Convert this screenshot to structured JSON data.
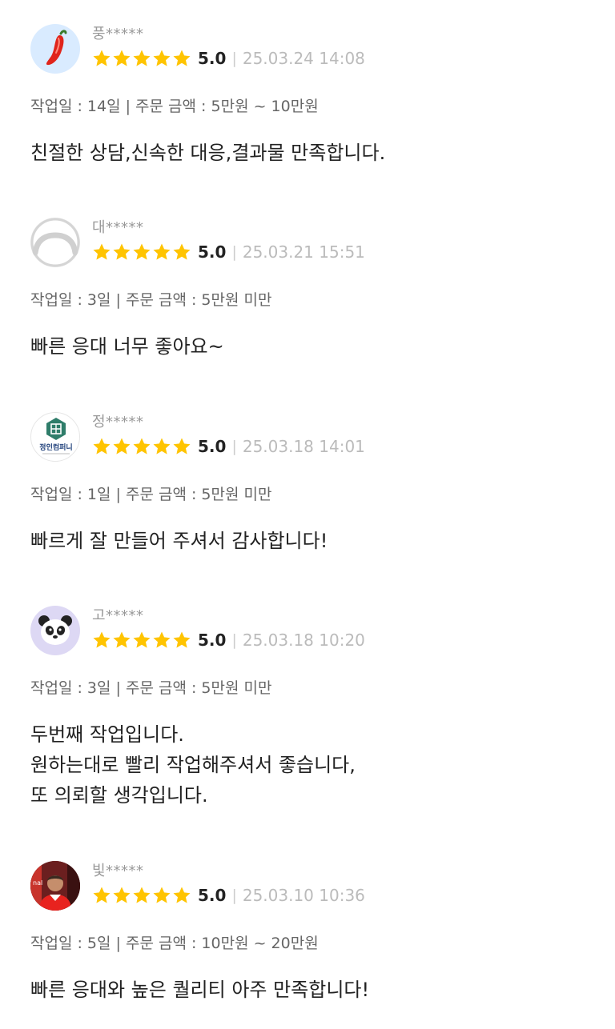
{
  "colors": {
    "star": "#FFC400",
    "date": "#BBBBBB",
    "meta": "#666666"
  },
  "reviews": [
    {
      "avatar_icon": "chili-pepper-icon",
      "nick": "풍*****",
      "score": "5.0",
      "stars": 5,
      "date": "25.03.24 14:08",
      "meta": "작업일 : 14일 | 주문 금액 : 5만원 ~ 10만원",
      "lines": [
        "친절한 상담,신속한 대응,결과물 만족합니다."
      ]
    },
    {
      "avatar_icon": "default-profile-icon",
      "nick": "대*****",
      "score": "5.0",
      "stars": 5,
      "date": "25.03.21 15:51",
      "meta": "작업일 : 3일 | 주문 금액 : 5만원 미만",
      "lines": [
        "빠른 응대 너무 좋아요~"
      ]
    },
    {
      "avatar_icon": "company-logo-icon",
      "avatar_text": "정인컴퍼니",
      "nick": "정*****",
      "score": "5.0",
      "stars": 5,
      "date": "25.03.18 14:01",
      "meta": "작업일 : 1일 | 주문 금액 : 5만원 미만",
      "lines": [
        "빠르게 잘 만들어 주셔서 감사합니다!"
      ]
    },
    {
      "avatar_icon": "panda-icon",
      "nick": "고*****",
      "score": "5.0",
      "stars": 5,
      "date": "25.03.18 10:20",
      "meta": "작업일 : 3일 | 주문 금액 : 5만원 미만",
      "lines": [
        "두번째 작업입니다.",
        "원하는대로 빨리 작업해주셔서 좋습니다,",
        "또 의뢰할 생각입니다."
      ]
    },
    {
      "avatar_icon": "football-player-photo-icon",
      "nick": "빛*****",
      "score": "5.0",
      "stars": 5,
      "date": "25.03.10 10:36",
      "meta": "작업일 : 5일 | 주문 금액 : 10만원 ~ 20만원",
      "lines": [
        "빠른 응대와 높은 퀄리티 아주 만족합니다!"
      ]
    }
  ]
}
